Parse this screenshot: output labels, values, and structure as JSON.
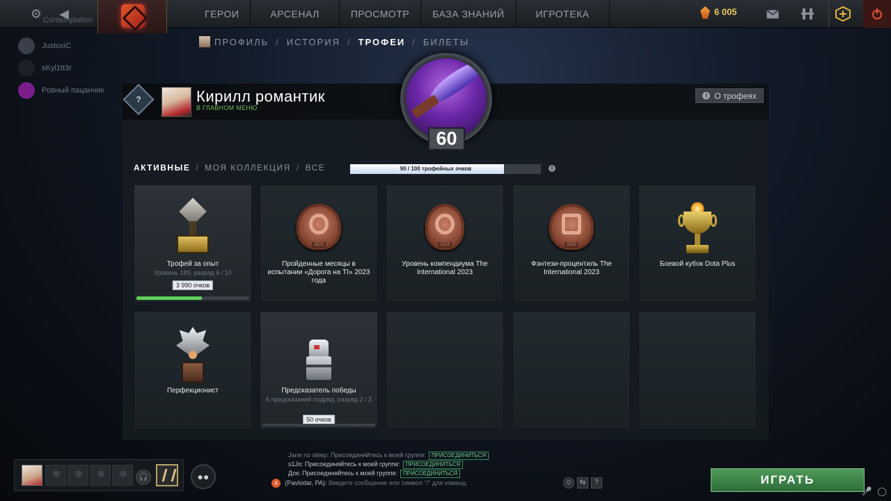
{
  "topbar": {
    "settings_icon": "gear-icon",
    "back_icon": "back-arrow-icon",
    "nav": [
      "ГЕРОИ",
      "АРСЕНАЛ",
      "ПРОСМОТР",
      "БАЗА ЗНАНИЙ",
      "ИГРОТЕКА"
    ],
    "currency_value": "6 005",
    "right_icons": [
      "mail-icon",
      "armory-icon",
      "dota-plus-icon",
      "power-icon"
    ]
  },
  "friends": {
    "ghost_label": "Contemplation",
    "items": [
      {
        "name": "JustoxiC"
      },
      {
        "name": "sKyl1tt3r"
      },
      {
        "name": "Ровный пацанчик"
      }
    ]
  },
  "subnav": {
    "items": [
      "ПРОФИЛЬ",
      "ИСТОРИЯ",
      "ТРОФЕИ",
      "БИЛЕТЫ"
    ],
    "separator": "/",
    "active_index": 2
  },
  "profile": {
    "rank_icon": "?",
    "name": "Кирилл романтик",
    "status": "В ГЛАВНОМ МЕНЮ",
    "about_label": "О трофеях",
    "level": "60"
  },
  "trophies": {
    "filters": [
      "АКТИВНЫЕ",
      "МОЯ КОЛЛЕКЦИЯ",
      "ВСЕ"
    ],
    "progress_text": "90 / 100 трофейных очков",
    "progress_fraction": 0.9,
    "cards": [
      {
        "title": "Трофей за опыт",
        "subtitle": "Уровень 189, разряд 6 / 10",
        "points": "3 990 очков",
        "progress": 0.58,
        "art": "cube"
      },
      {
        "title": "Пройденные месяцы в испытании «Дорога на TI» 2023 года",
        "art": "road-medal",
        "year": "2023"
      },
      {
        "title": "Уровень компендиума The International 2023",
        "art": "ti-medal",
        "year": "2023"
      },
      {
        "title": "Фэнтези-процентиль The International 2023",
        "art": "fantasy-medal",
        "year": "2023"
      },
      {
        "title": "Боевой кубок Dota Plus",
        "art": "cup"
      },
      {
        "title": "Перфекционист",
        "art": "silver-crown"
      },
      {
        "title": "Предсказатель победы",
        "subtitle": "6 предсказаний подряд, разряд 2 / 3",
        "points": "50 очков",
        "art": "robot"
      }
    ]
  },
  "bottom": {
    "chat": [
      {
        "name": "Jane no sleep",
        "text": "Присоединяйтесь к моей группе:",
        "join": "ПРИСОЕДИНИТЬСЯ",
        "faded": true
      },
      {
        "name": "s1Jo",
        "text": "Присоединяйтесь к моей группе:",
        "join": "ПРИСОЕДИНИТЬСЯ"
      },
      {
        "name": "Док",
        "text": "Присоединяйтесь к моей группе:",
        "join": "ПРИСОЕДИНИТЬСЯ"
      }
    ],
    "chat_badge": "4",
    "chat_channel": "(Pavlodar, PA):",
    "chat_placeholder": "Введите сообщение или символ \"/\" для команд.",
    "play_label": "ИГРАТЬ"
  }
}
